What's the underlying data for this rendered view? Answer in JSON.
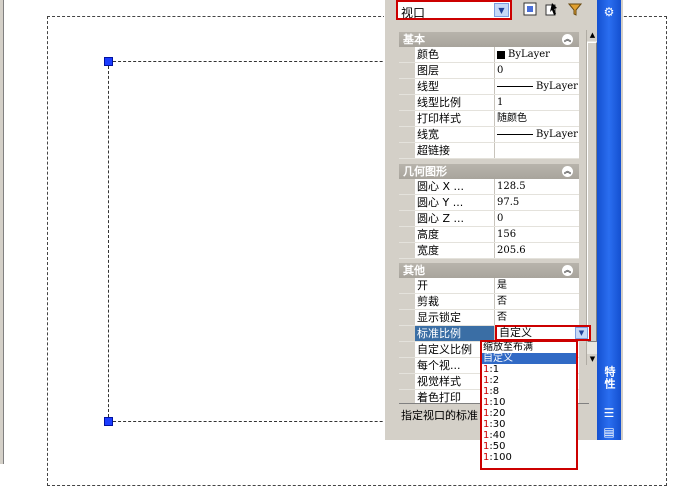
{
  "palette": {
    "title": "特性",
    "object_type": "视口",
    "toolbar": {
      "quick_select_icon": "quick-select-icon",
      "select_objects_icon": "select-objects-icon",
      "toggle_pickadd_icon": "toggle-pickadd-icon"
    },
    "sections": {
      "general": {
        "header": "基本",
        "rows": [
          {
            "label": "颜色",
            "value": "ByLayer"
          },
          {
            "label": "图层",
            "value": "0"
          },
          {
            "label": "线型",
            "value": "ByLayer"
          },
          {
            "label": "线型比例",
            "value": "1"
          },
          {
            "label": "打印样式",
            "value": "随颜色"
          },
          {
            "label": "线宽",
            "value": "ByLayer"
          },
          {
            "label": "超链接",
            "value": ""
          }
        ]
      },
      "geometry": {
        "header": "几何图形",
        "rows": [
          {
            "label": "圆心 X ...",
            "value": "128.5"
          },
          {
            "label": "圆心 Y ...",
            "value": "97.5"
          },
          {
            "label": "圆心 Z ...",
            "value": "0"
          },
          {
            "label": "高度",
            "value": "156"
          },
          {
            "label": "宽度",
            "value": "205.6"
          }
        ]
      },
      "misc": {
        "header": "其他",
        "rows": [
          {
            "label": "开",
            "value": "是"
          },
          {
            "label": "剪裁",
            "value": "否"
          },
          {
            "label": "显示锁定",
            "value": "否"
          },
          {
            "label": "标准比例",
            "value": "自定义"
          },
          {
            "label": "自定义比例",
            "value": ""
          },
          {
            "label": "每个视...",
            "value": ""
          },
          {
            "label": "视觉样式",
            "value": ""
          },
          {
            "label": "着色打印",
            "value": ""
          }
        ]
      }
    },
    "scale_dropdown": {
      "options": [
        "缩放至布满",
        "自定义",
        "1:1",
        "1:2",
        "1:8",
        "1:10",
        "1:20",
        "1:30",
        "1:40",
        "1:50",
        "1:100"
      ],
      "highlighted": "自定义"
    },
    "description": "指定视口的标准"
  },
  "colors": {
    "accent_red": "#cc0000",
    "titlebar_blue": "#1450d0",
    "grip_blue": "#1a3cff"
  }
}
